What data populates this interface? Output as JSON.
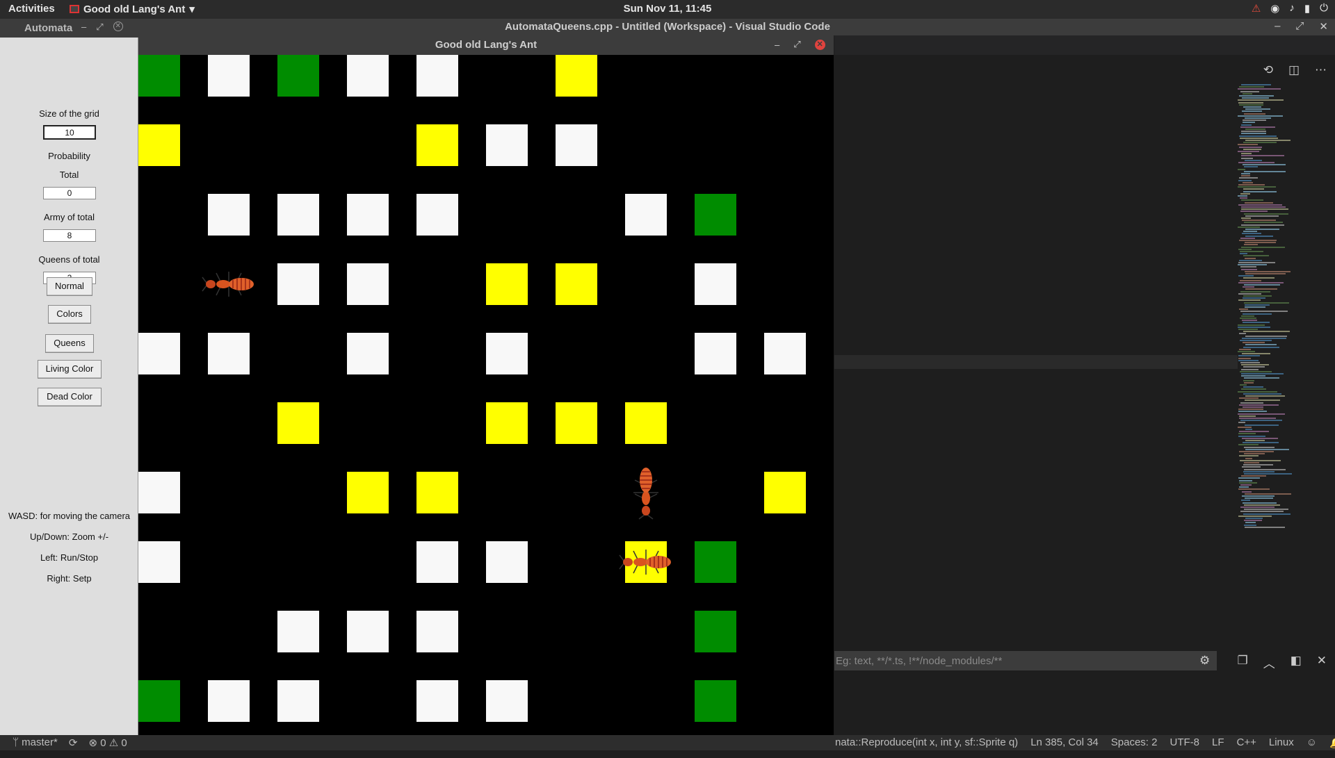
{
  "topbar": {
    "activities": "Activities",
    "app_menu": "Good old Lang's Ant",
    "clock": "Sun Nov 11, 11:45",
    "tray": [
      "warning-icon",
      "wifi-icon",
      "volume-icon",
      "battery-icon",
      "power-icon"
    ]
  },
  "vscode": {
    "title": "AutomataQueens.cpp - Untitled (Workspace) - Visual Studio Code",
    "search_placeholder": "Eg: text, **/*.ts, !**/node_modules/**"
  },
  "statusbar": {
    "branch": "master*",
    "sync_icon": "sync-icon",
    "problems": "0",
    "warnings": "0",
    "function": "nata::Reproduce(int x, int y, sf::Sprite q)",
    "position": "Ln 385, Col 34",
    "spaces": "Spaces: 2",
    "encoding": "UTF-8",
    "eol": "LF",
    "language": "C++",
    "os": "Linux"
  },
  "automata": {
    "title": "Automata",
    "size_label": "Size of the grid",
    "size_value": "10",
    "probability_label": "Probability",
    "total_label": "Total",
    "total_value": "0",
    "army_label": "Army of total",
    "army_value": "8",
    "queens_label": "Queens of total",
    "queens_value": "2",
    "buttons": {
      "normal": "Normal",
      "colors": "Colors",
      "queens": "Queens",
      "living": "Living Color",
      "dead": "Dead Color"
    },
    "help": [
      "WASD: for moving the camera",
      "Up/Down: Zoom +/-",
      "Left: Run/Stop",
      "Right: Setp"
    ]
  },
  "ant_window": {
    "title": "Good old Lang's Ant",
    "grid_size": 10,
    "colors": {
      "W": "#f8f8f8",
      "Y": "#ffff00",
      "G": "#008c00"
    },
    "grid": [
      [
        "G",
        "W",
        "G",
        "W",
        "W",
        "",
        "Y",
        "",
        "",
        ""
      ],
      [
        "Y",
        "",
        "",
        "",
        "Y",
        "W",
        "W",
        "",
        "",
        ""
      ],
      [
        "",
        "W",
        "W",
        "W",
        "W",
        "",
        "",
        "W",
        "G",
        ""
      ],
      [
        "",
        "",
        "W",
        "W",
        "",
        "Y",
        "Y",
        "",
        "W",
        ""
      ],
      [
        "W",
        "W",
        "",
        "W",
        "",
        "W",
        "",
        "",
        "W",
        "W"
      ],
      [
        "",
        "",
        "Y",
        "",
        "",
        "Y",
        "Y",
        "Y",
        "",
        ""
      ],
      [
        "W",
        "",
        "",
        "Y",
        "Y",
        "",
        "",
        "",
        "",
        "Y"
      ],
      [
        "W",
        "",
        "",
        "",
        "W",
        "W",
        "",
        "Y",
        "G",
        ""
      ],
      [
        "",
        "",
        "W",
        "W",
        "W",
        "",
        "",
        "",
        "G",
        ""
      ],
      [
        "G",
        "W",
        "W",
        "",
        "W",
        "W",
        "",
        "",
        "G",
        ""
      ]
    ],
    "ants": [
      {
        "row": 3,
        "col": 1,
        "direction": "horizontal"
      },
      {
        "row": 6,
        "col": 7,
        "direction": "vertical"
      },
      {
        "row": 7,
        "col": 7,
        "direction": "horizontal"
      }
    ]
  }
}
